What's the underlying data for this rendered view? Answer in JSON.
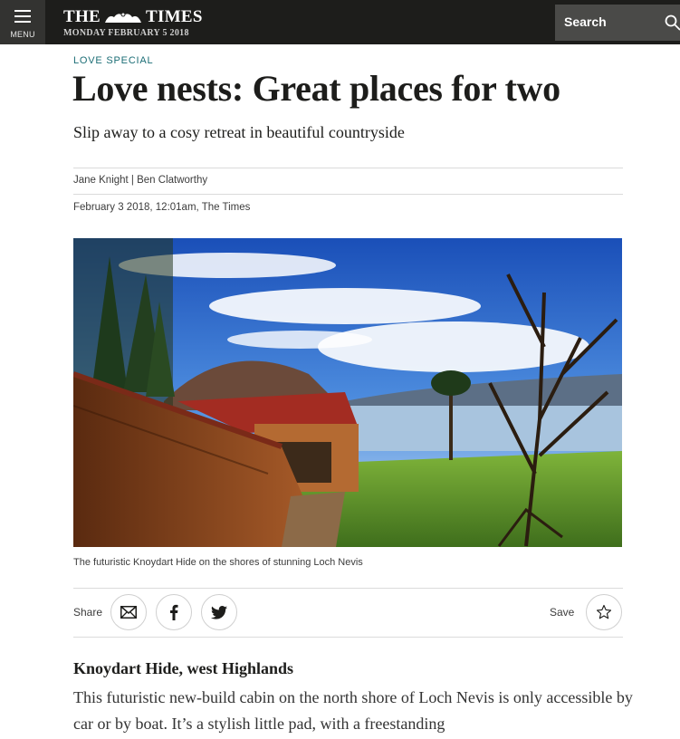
{
  "header": {
    "menu_label": "MENU",
    "masthead_left": "THE",
    "masthead_right": "TIMES",
    "dateline": "MONDAY FEBRUARY 5 2018",
    "search_label": "Search"
  },
  "article": {
    "section": "LOVE SPECIAL",
    "headline": "Love nests: Great places for two",
    "standfirst": "Slip away to a cosy retreat in beautiful countryside",
    "byline": "Jane Knight | Ben Clatworthy",
    "published": "February 3 2018, 12:01am, The Times",
    "image_caption": "The futuristic Knoydart Hide on the shores of stunning Loch Nevis",
    "subhead": "Knoydart Hide, west Highlands",
    "body": "This futuristic new-build cabin on the north shore of Loch Nevis is only accessible by car or by boat. It’s a stylish little pad, with a freestanding"
  },
  "share": {
    "label": "Share",
    "buttons": [
      "email-icon",
      "facebook-icon",
      "twitter-icon"
    ],
    "save_label": "Save"
  },
  "colors": {
    "header_bg": "#1d1d1b",
    "section_teal": "#1b6d75",
    "search_bg": "#4a4a48"
  }
}
